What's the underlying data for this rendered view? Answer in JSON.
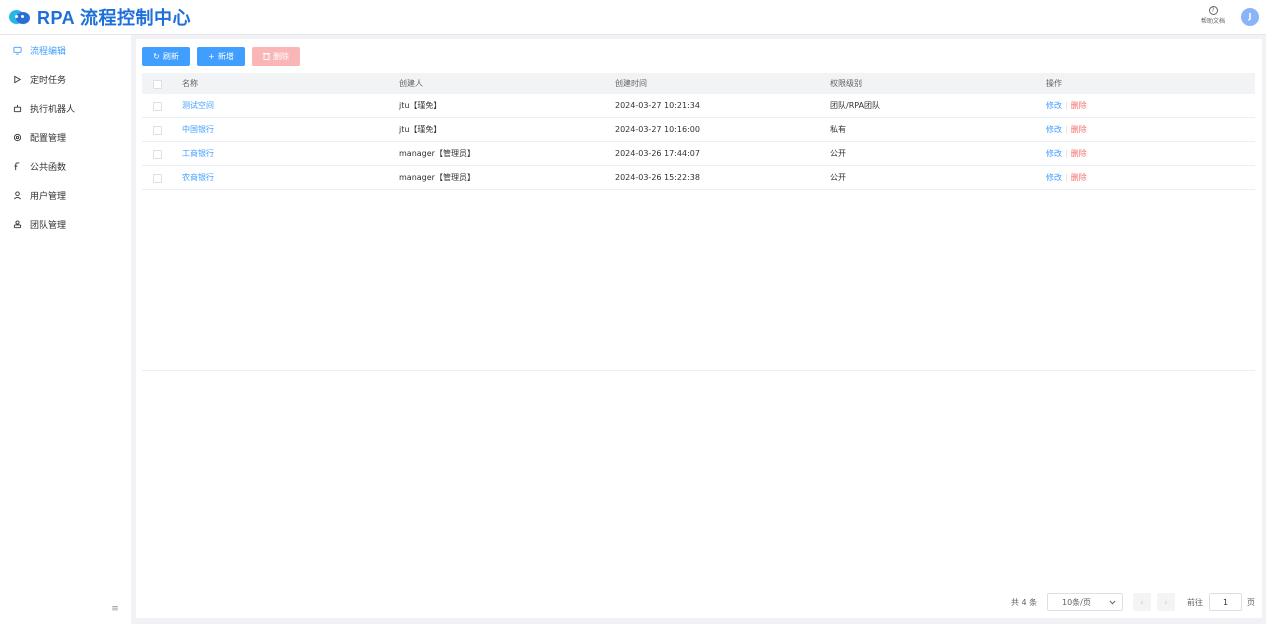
{
  "app": {
    "title": "RPA 流程控制中心"
  },
  "header": {
    "help_icon": "help-circle-icon",
    "help_label": "帮助文档",
    "avatar_initial": "J"
  },
  "sidebar": {
    "items": [
      {
        "label": "流程编辑",
        "icon": "monitor-icon",
        "active": true
      },
      {
        "label": "定时任务",
        "icon": "play-icon",
        "active": false
      },
      {
        "label": "执行机器人",
        "icon": "robot-icon",
        "active": false
      },
      {
        "label": "配置管理",
        "icon": "gear-icon",
        "active": false
      },
      {
        "label": "公共函数",
        "icon": "function-icon",
        "active": false
      },
      {
        "label": "用户管理",
        "icon": "user-icon",
        "active": false
      },
      {
        "label": "团队管理",
        "icon": "team-icon",
        "active": false
      }
    ],
    "collapse_icon": "menu-fold-icon"
  },
  "toolbar": {
    "refresh_label": "刷新",
    "add_label": "新增",
    "delete_label": "删除"
  },
  "table": {
    "columns": {
      "name": "名称",
      "creator": "创建人",
      "created_time": "创建时间",
      "permission": "权限级别",
      "ops": "操作"
    },
    "rows": [
      {
        "name": "测试空间",
        "creator": "jtu【瑾免】",
        "created_time": "2024-03-27 10:21:34",
        "permission": "团队/RPA团队",
        "edit": "修改",
        "delete": "删除"
      },
      {
        "name": "中国银行",
        "creator": "jtu【瑾免】",
        "created_time": "2024-03-27 10:16:00",
        "permission": "私有",
        "edit": "修改",
        "delete": "删除"
      },
      {
        "name": "工商银行",
        "creator": "manager【管理员】",
        "created_time": "2024-03-26 17:44:07",
        "permission": "公开",
        "edit": "修改",
        "delete": "删除"
      },
      {
        "name": "农商银行",
        "creator": "manager【管理员】",
        "created_time": "2024-03-26 15:22:38",
        "permission": "公开",
        "edit": "修改",
        "delete": "删除"
      }
    ]
  },
  "pagination": {
    "total_text": "共 4 条",
    "page_size": "10条/页",
    "goto_label": "前往",
    "current_page": "1",
    "page_unit": "页"
  },
  "colors": {
    "primary": "#409eff",
    "danger": "#f56c6c",
    "brand": "#1e6fd8"
  }
}
